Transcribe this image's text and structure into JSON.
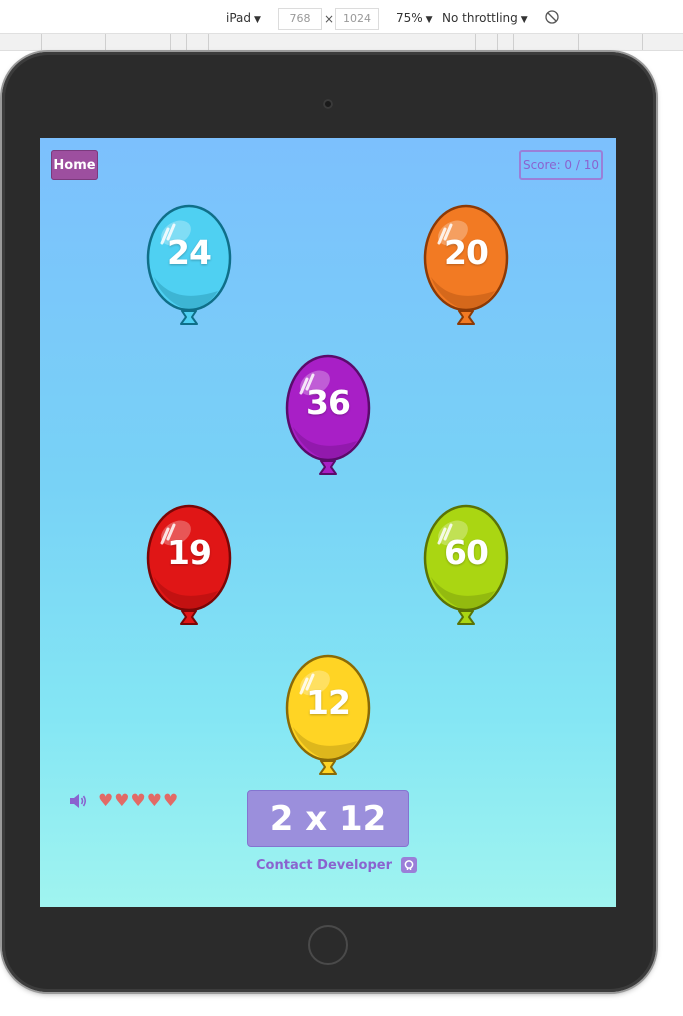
{
  "devtools": {
    "device": "iPad",
    "width": "768",
    "times": "×",
    "height": "1024",
    "zoom": "75%",
    "throttling": "No throttling",
    "rotate_icon": "rotate-icon"
  },
  "game": {
    "home_label": "Home",
    "score_text": "Score: 0 / 10",
    "balloons": [
      {
        "value": "24",
        "color": "#4fd0f2",
        "dark": "#0f6f89"
      },
      {
        "value": "20",
        "color": "#f27a23",
        "dark": "#8c3a06"
      },
      {
        "value": "36",
        "color": "#a81fc6",
        "dark": "#5a0b6b"
      },
      {
        "value": "19",
        "color": "#e01616",
        "dark": "#7a0606"
      },
      {
        "value": "60",
        "color": "#aad612",
        "dark": "#5a7206"
      },
      {
        "value": "12",
        "color": "#ffd424",
        "dark": "#8a6a06"
      }
    ],
    "lives": 5,
    "heart_color": "#e26a66",
    "question": "2 x 12",
    "contact_label": "Contact Developer",
    "sound_icon": "speaker-icon",
    "github_icon": "github-icon"
  }
}
